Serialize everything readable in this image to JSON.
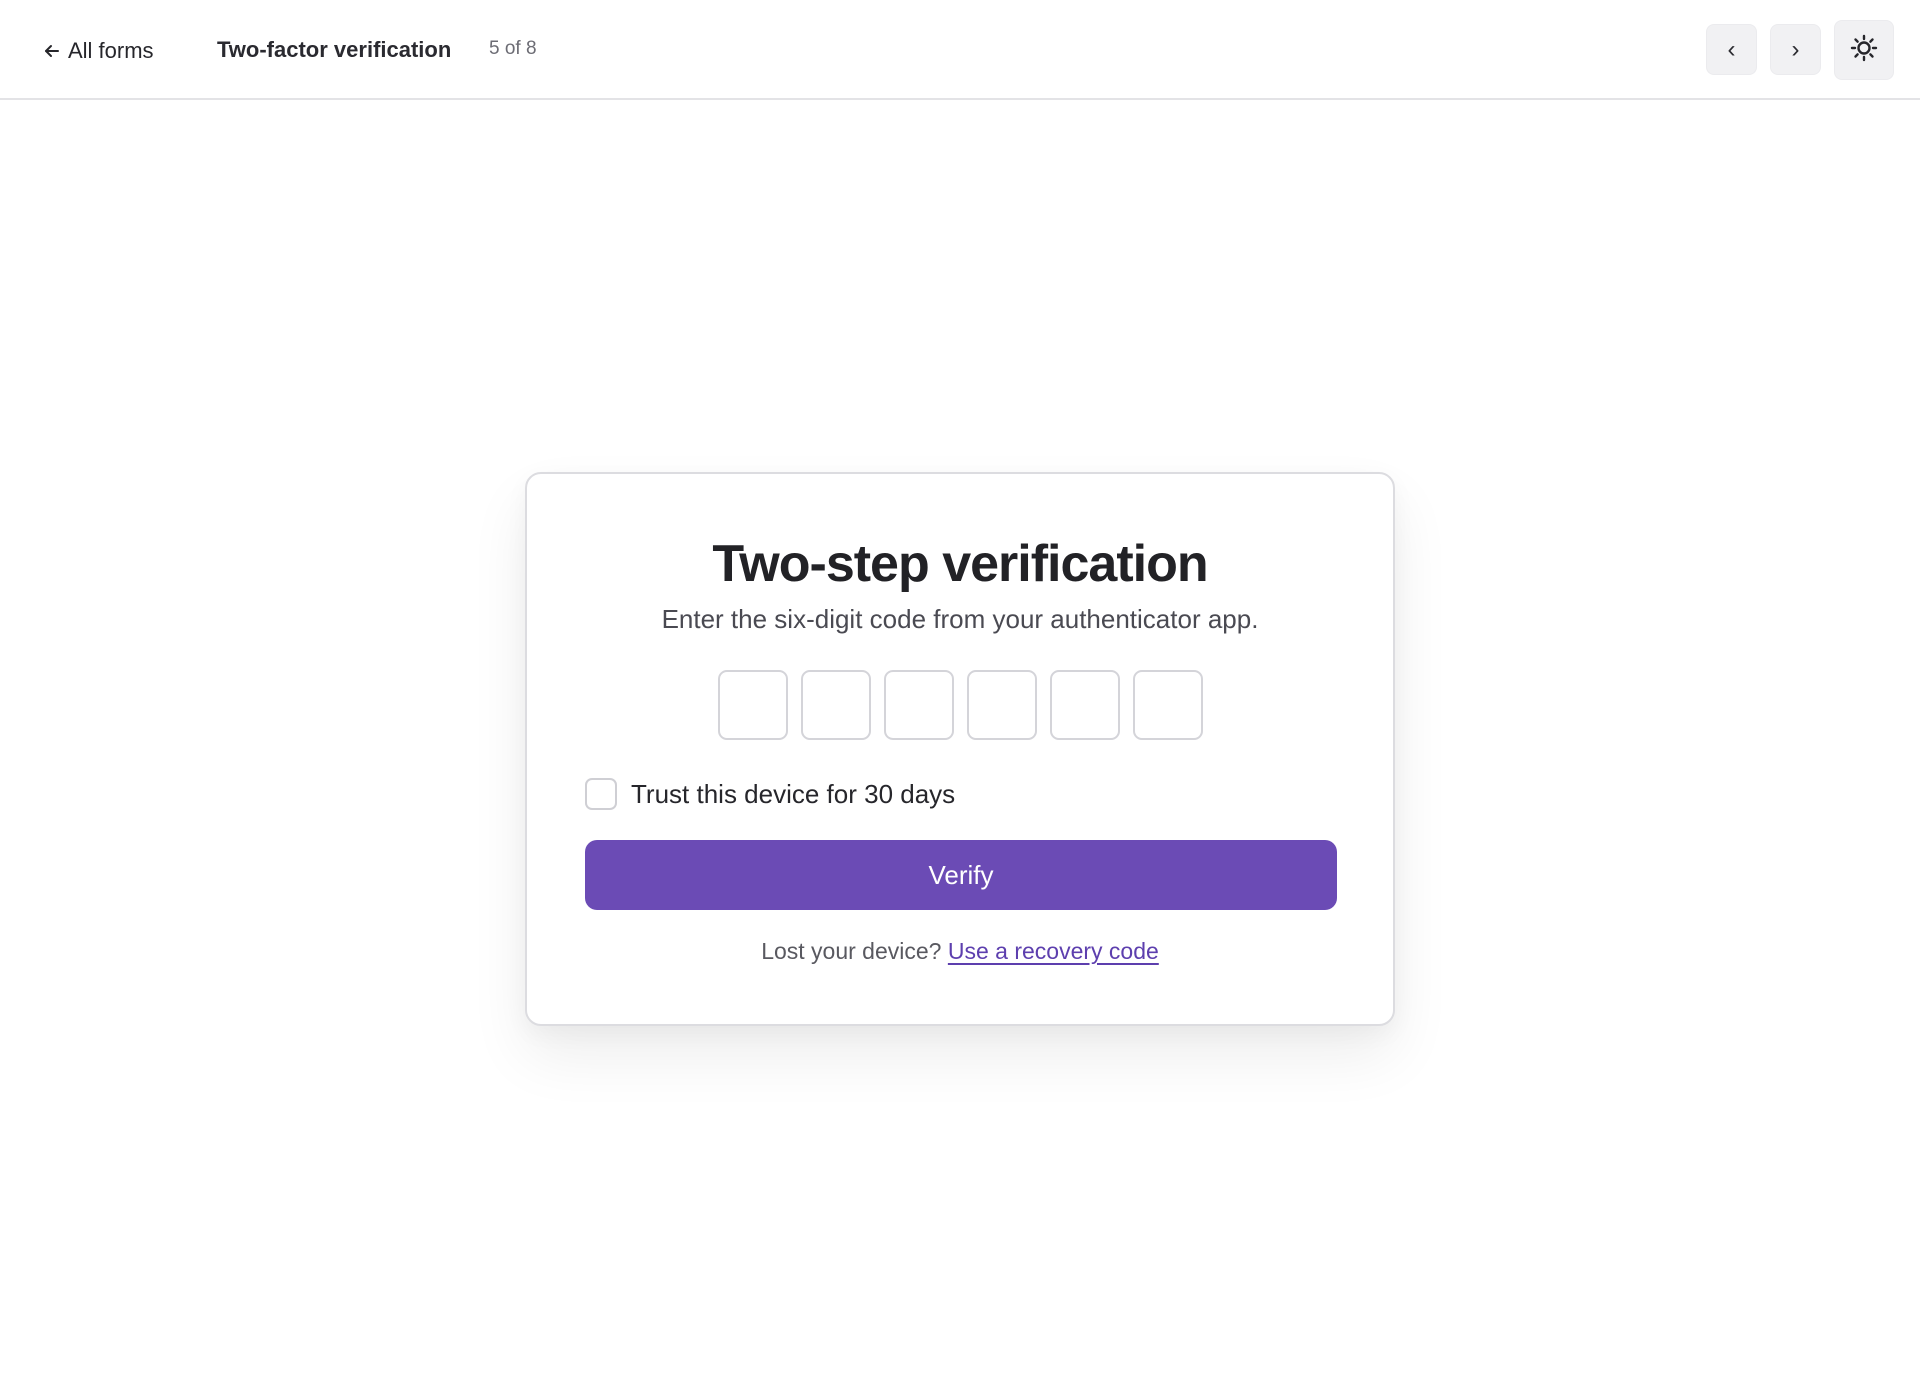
{
  "header": {
    "back_label": "All forms",
    "form_title": "Two-factor verification",
    "counter": "5 of 8",
    "prev_glyph": "‹",
    "next_glyph": "›",
    "icons": {
      "back": "arrow-left-icon",
      "theme": "sun-icon"
    }
  },
  "card": {
    "title": "Two-step verification",
    "subtitle": "Enter the six-digit code from your authenticator app.",
    "code_digits": [
      "",
      "",
      "",
      "",
      "",
      ""
    ],
    "trust_label": "Trust this device for 30 days",
    "trust_checked": false,
    "verify_label": "Verify",
    "recovery_prompt": "Lost your device?",
    "recovery_link": "Use a recovery code"
  },
  "colors": {
    "accent": "#6b4bb5",
    "link": "#5d3fae",
    "border": "#dcdce0",
    "button_bg": "#f1f1f3"
  }
}
